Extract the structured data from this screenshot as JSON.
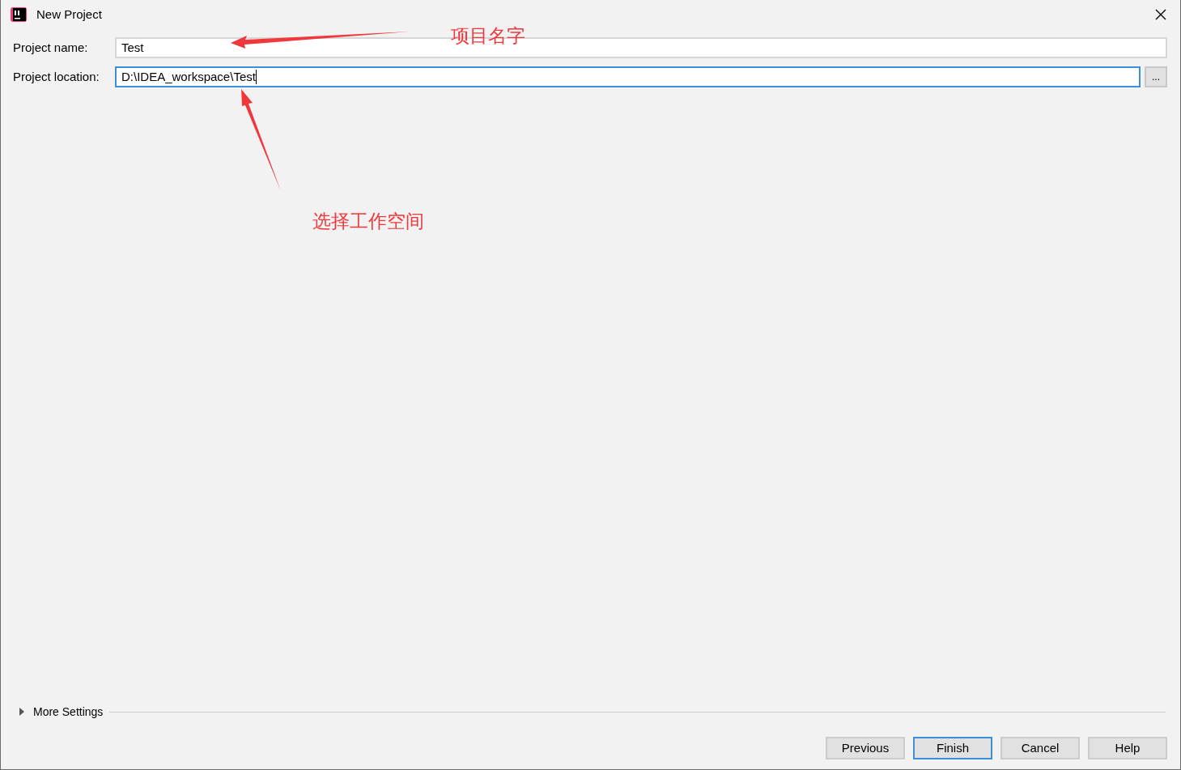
{
  "window": {
    "title": "New Project"
  },
  "fields": [
    {
      "label": "Project name:",
      "value": "Test",
      "focused": false
    },
    {
      "label": "Project location:",
      "value": "D:\\IDEA_workspace\\Test",
      "focused": true,
      "browse": "..."
    }
  ],
  "more_settings": {
    "label": "More Settings",
    "expanded": false
  },
  "buttons": [
    {
      "label": "Previous",
      "default": false
    },
    {
      "label": "Finish",
      "default": true
    },
    {
      "label": "Cancel",
      "default": false
    },
    {
      "label": "Help",
      "default": false
    }
  ],
  "annotations": [
    {
      "text": "项目名字"
    },
    {
      "text": "选择工作空间"
    }
  ]
}
